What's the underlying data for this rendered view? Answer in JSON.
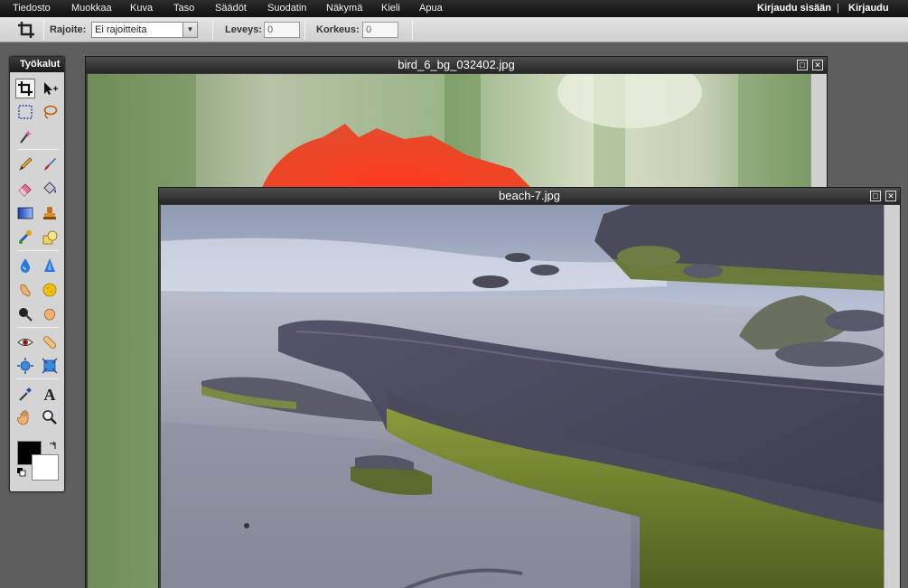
{
  "menu": {
    "items": [
      "Tiedosto",
      "Muokkaa",
      "Kuva",
      "Taso",
      "Säädöt",
      "Suodatin",
      "Näkymä",
      "Kieli",
      "Apua"
    ],
    "signin": "Kirjaudu sisään",
    "separator": "|",
    "signup": "Kirjaudu"
  },
  "options": {
    "constraint_label": "Rajoite:",
    "constraint_value": "Ei rajoitteita",
    "width_label": "Leveys:",
    "width_value": "0",
    "height_label": "Korkeus:",
    "height_value": "0"
  },
  "tools": {
    "title": "Työkalut",
    "items": [
      "crop-tool",
      "move-tool",
      "marquee-tool",
      "lasso-tool",
      "magic-wand-tool",
      "pencil-tool",
      "brush-tool",
      "eraser-tool",
      "paint-bucket-tool",
      "gradient-tool",
      "clone-stamp-tool",
      "color-replace-tool",
      "shape-tool",
      "blur-tool",
      "sharpen-tool",
      "smudge-tool",
      "sponge-tool",
      "dodge-tool",
      "burn-tool",
      "red-eye-tool",
      "spot-heal-tool",
      "bloat-tool",
      "pinch-tool",
      "color-picker-tool",
      "type-tool",
      "hand-tool",
      "zoom-tool"
    ],
    "foreground_color": "#000000",
    "background_color": "#ffffff"
  },
  "windows": [
    {
      "title": "bird_6_bg_032402.jpg"
    },
    {
      "title": "beach-7.jpg"
    }
  ]
}
